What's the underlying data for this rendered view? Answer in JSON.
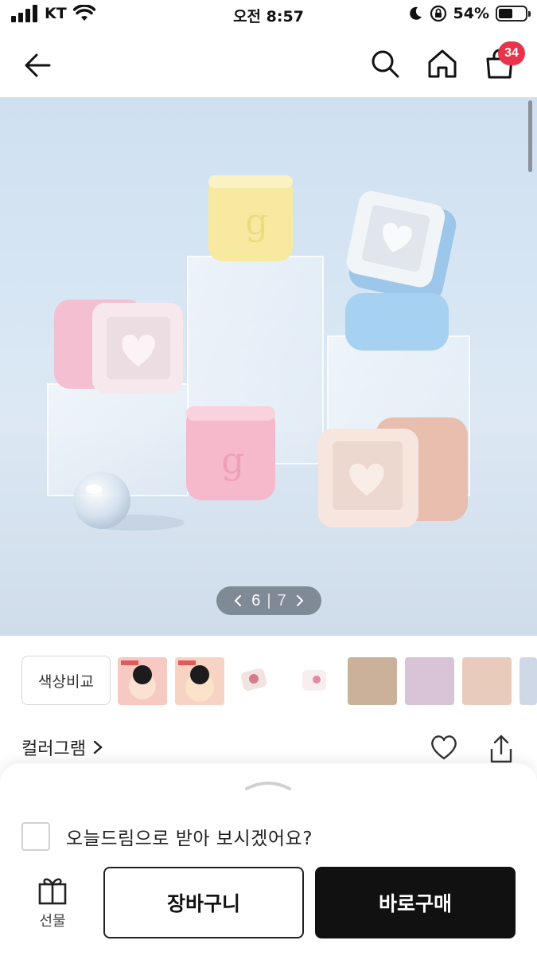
{
  "status_bar": {
    "carrier": "KT",
    "time": "오전 8:57",
    "battery": "54%"
  },
  "nav": {
    "cart_count": "34"
  },
  "gallery": {
    "current": "6",
    "separator": "|",
    "total": "7"
  },
  "swatches": {
    "compare_label": "색상비교",
    "thumb_colors": [
      "#f6c9c2",
      "#f6d3c3",
      "#f1e4e0",
      "#f7eef0",
      "#cbb19a",
      "#d8c4d6",
      "#e8cbbb",
      "#cfd8e6"
    ]
  },
  "brand": {
    "name": "컬러그램"
  },
  "sheet": {
    "today_dream_label": "오늘드림으로 받아 보시겠어요?",
    "gift_label": "선물",
    "cart_button": "장바구니",
    "buy_button": "바로구매"
  }
}
